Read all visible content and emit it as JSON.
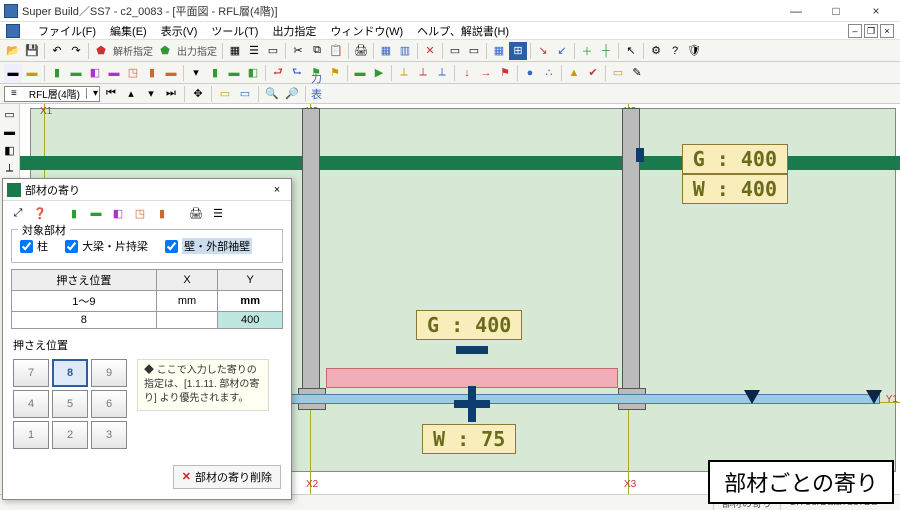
{
  "window": {
    "title": "Super Build／SS7 - c2_0083 - [平面図 - RFL層(4階)]",
    "controls": {
      "min": "—",
      "max": "□",
      "close": "×"
    },
    "child_controls": {
      "min": "–",
      "max": "❐",
      "close": "×"
    }
  },
  "menu": [
    "ファイル(F)",
    "編集(E)",
    "表示(V)",
    "ツール(T)",
    "出力指定",
    "ウィンドウ(W)",
    "ヘルプ、解説書(H)"
  ],
  "layer_combo": {
    "icon": "≡",
    "label": "RFL層(4階)",
    "dd": "▾"
  },
  "axis_labels": {
    "x1": "X1",
    "x2": "X2",
    "x3": "X3",
    "y1": "Y1"
  },
  "tags": {
    "g1": "G : 400",
    "w1": "W : 400",
    "g2": "G : 400",
    "w2": "W : 75"
  },
  "dialog": {
    "title": "部材の寄り",
    "target_group": "対象部材",
    "chk_col": "柱",
    "chk_beam": "大梁・片持梁",
    "chk_wall": "壁・外部袖壁",
    "tbl": {
      "h1": "押さえ位置",
      "h2": "X",
      "h3": "Y",
      "u1": "1～9",
      "u2": "mm",
      "u3": "mm",
      "v1": "8",
      "v2": "",
      "v3": "400"
    },
    "keypad_title": "押さえ位置",
    "keys": [
      "7",
      "8",
      "9",
      "4",
      "5",
      "6",
      "1",
      "2",
      "3"
    ],
    "selected_key": "8",
    "note": "◆ ここで入力した寄りの指定は、[1.1.11. 部材の寄り] より優先されます。",
    "delete_btn": "部材の寄り削除"
  },
  "status": {
    "center": "部材の寄り",
    "right": "C:¥UsrData¥Ss7Da"
  },
  "caption": "部材ごとの寄り",
  "icons": {
    "app": "S7",
    "open": "📂",
    "save": "💾",
    "undo": "↶",
    "redo": "↷",
    "cut": "✂",
    "copy": "⧉",
    "paste": "📋",
    "print": "🖨",
    "zoomin": "🔍+",
    "zoomout": "🔍-",
    "pan": "✥",
    "grid": "▦",
    "layer": "☰",
    "settings": "⚙",
    "arrow": "↖",
    "plus": "＋",
    "axis": "┼",
    "flag": "⚑",
    "play": "▶",
    "rect": "▭",
    "help": "?",
    "shield": "🛡"
  }
}
